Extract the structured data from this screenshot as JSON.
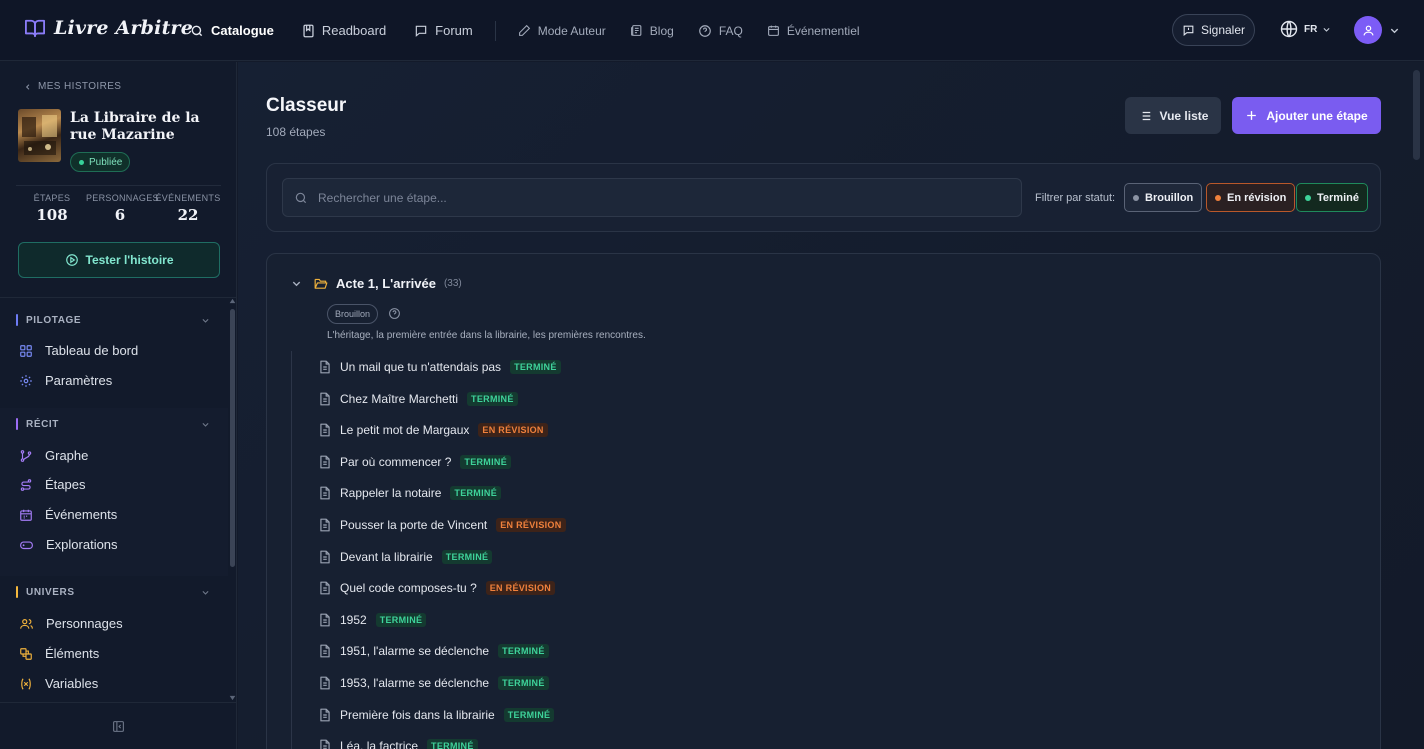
{
  "brand": {
    "name": "Livre Arbitre",
    "icon": "open-book-icon"
  },
  "nav": {
    "items": [
      {
        "label": "Catalogue",
        "icon": "search-icon",
        "active": true
      },
      {
        "label": "Readboard",
        "icon": "bookmark-book-icon"
      },
      {
        "label": "Forum",
        "icon": "chat-icon"
      }
    ],
    "secondary": [
      {
        "label": "Mode Auteur",
        "icon": "pen-icon"
      },
      {
        "label": "Blog",
        "icon": "newspaper-icon"
      },
      {
        "label": "FAQ",
        "icon": "help-circle-icon"
      },
      {
        "label": "Événementiel",
        "icon": "calendar-icon"
      }
    ],
    "signal_label": "Signaler",
    "lang": "FR"
  },
  "sidebar": {
    "back_label": "MES HISTOIRES",
    "story_title": "La Libraire de la rue Mazarine",
    "status": "Publiée",
    "stats": [
      {
        "label": "ÉTAPES",
        "value": "108"
      },
      {
        "label": "PERSONNAGES",
        "value": "6"
      },
      {
        "label": "ÉVÉNEMENTS",
        "value": "22"
      }
    ],
    "test_label": "Tester l'histoire",
    "sections": [
      {
        "title": "PILOTAGE",
        "color": "#6d7cf5",
        "items": [
          "Tableau de bord",
          "Paramètres"
        ]
      },
      {
        "title": "RÉCIT",
        "color": "#9b6cf5",
        "items": [
          "Graphe",
          "Étapes",
          "Événements",
          "Explorations"
        ]
      },
      {
        "title": "UNIVERS",
        "color": "#f5b83d",
        "items": [
          "Personnages",
          "Éléments",
          "Variables"
        ]
      }
    ]
  },
  "main": {
    "title": "Classeur",
    "subtitle": "108 étapes",
    "list_view_label": "Vue liste",
    "add_step_label": "Ajouter une étape",
    "search_placeholder": "Rechercher une étape...",
    "filter_label": "Filtrer par statut:",
    "filters": [
      {
        "label": "Brouillon",
        "dot": "#8b93a3"
      },
      {
        "label": "En révision",
        "dot": "#f0813c"
      },
      {
        "label": "Terminé",
        "dot": "#3ed39a"
      }
    ],
    "act": {
      "title": "Acte 1, L'arrivée",
      "count": "(33)",
      "status": "Brouillon",
      "description": "L'héritage, la première entrée dans la librairie, les premières rencontres."
    },
    "steps": [
      {
        "title": "Un mail que tu n'attendais pas",
        "status": "TERMINÉ"
      },
      {
        "title": "Chez Maître Marchetti",
        "status": "TERMINÉ"
      },
      {
        "title": "Le petit mot de Margaux",
        "status": "EN RÉVISION"
      },
      {
        "title": "Par où commencer ?",
        "status": "TERMINÉ"
      },
      {
        "title": "Rappeler la notaire",
        "status": "TERMINÉ"
      },
      {
        "title": "Pousser la porte de Vincent",
        "status": "EN RÉVISION"
      },
      {
        "title": "Devant la librairie",
        "status": "TERMINÉ"
      },
      {
        "title": "Quel code composes-tu ?",
        "status": "EN RÉVISION"
      },
      {
        "title": "1952",
        "status": "TERMINÉ"
      },
      {
        "title": "1951, l'alarme se déclenche",
        "status": "TERMINÉ"
      },
      {
        "title": "1953, l'alarme se déclenche",
        "status": "TERMINÉ"
      },
      {
        "title": "Première fois dans la librairie",
        "status": "TERMINÉ"
      },
      {
        "title": "Léa, la factrice",
        "status": "TERMINÉ"
      }
    ]
  }
}
